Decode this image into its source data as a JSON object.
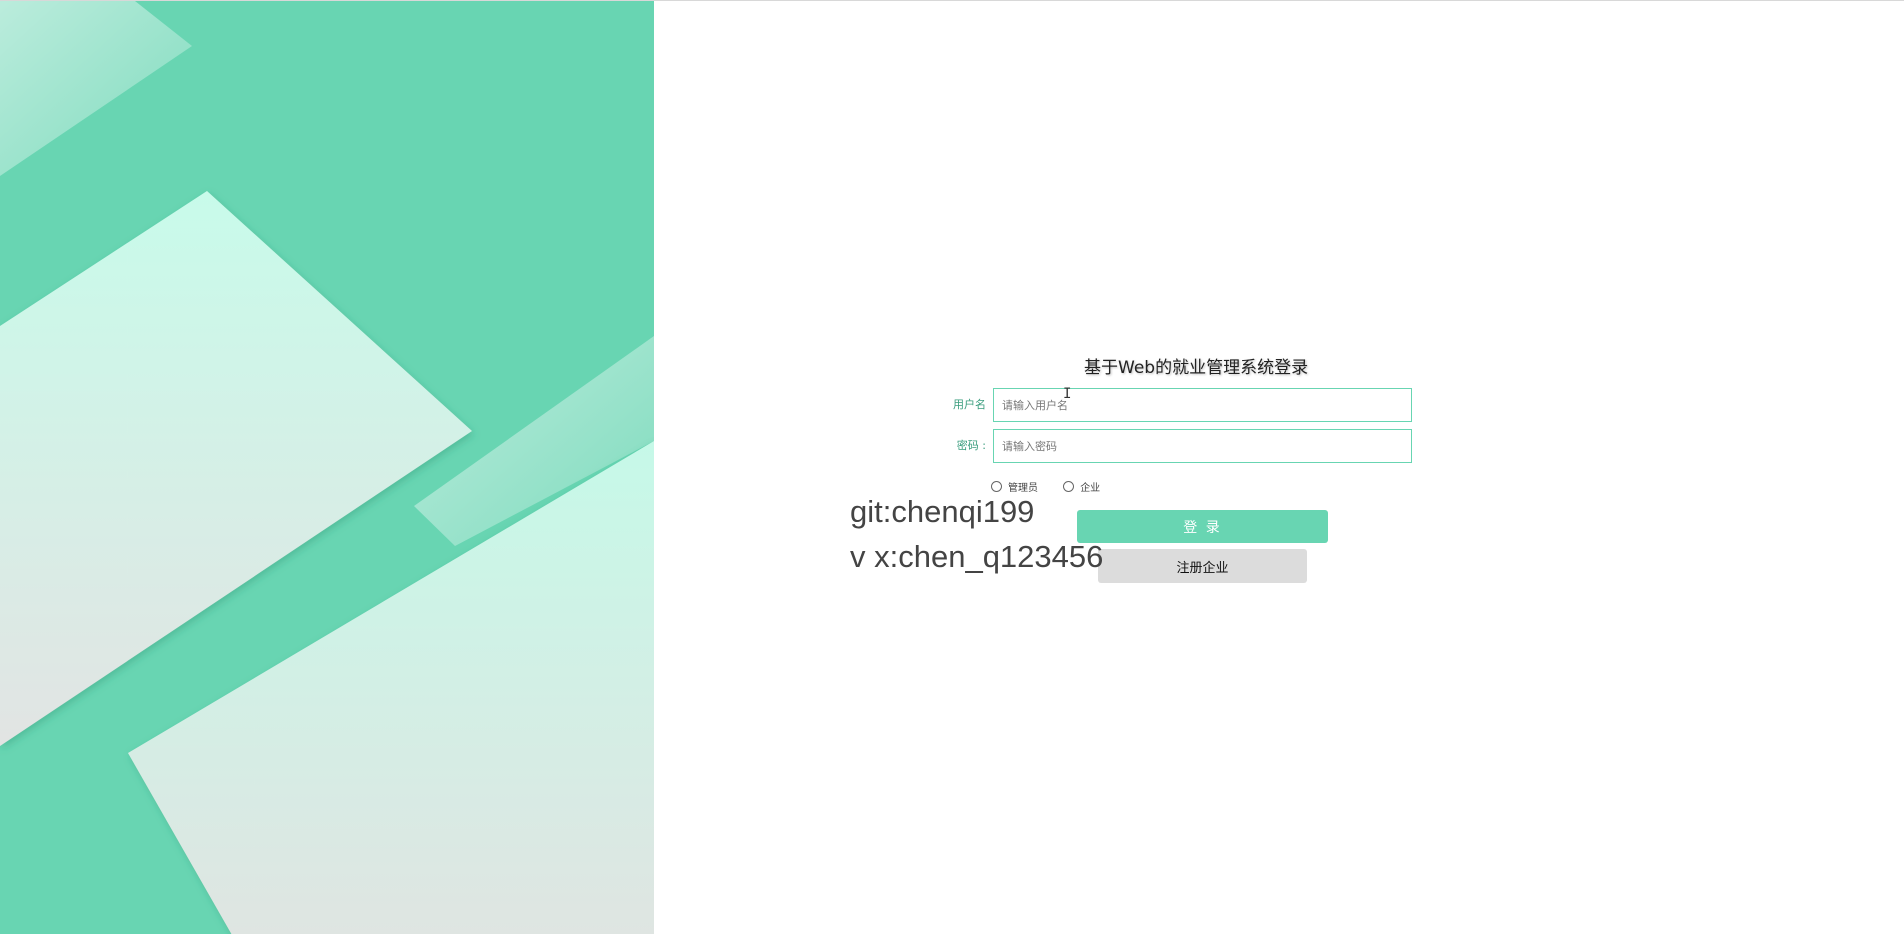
{
  "login": {
    "title": "基于Web的就业管理系统登录",
    "username_label": "用户名",
    "username_placeholder": "请输入用户名",
    "username_value": "",
    "password_label": "密码 :",
    "password_placeholder": "请输入密码",
    "password_value": "",
    "roles": [
      {
        "label": "管理员",
        "selected": false
      },
      {
        "label": "企业",
        "selected": false
      }
    ],
    "login_button": "登 录",
    "register_button": "注册企业"
  },
  "watermark": {
    "line1": "git:chenqi199",
    "line2": "v x:chen_q123456"
  },
  "colors": {
    "accent": "#68d5b2",
    "panel_light": "#c8fbea",
    "register_bg": "#dcdcdc"
  }
}
